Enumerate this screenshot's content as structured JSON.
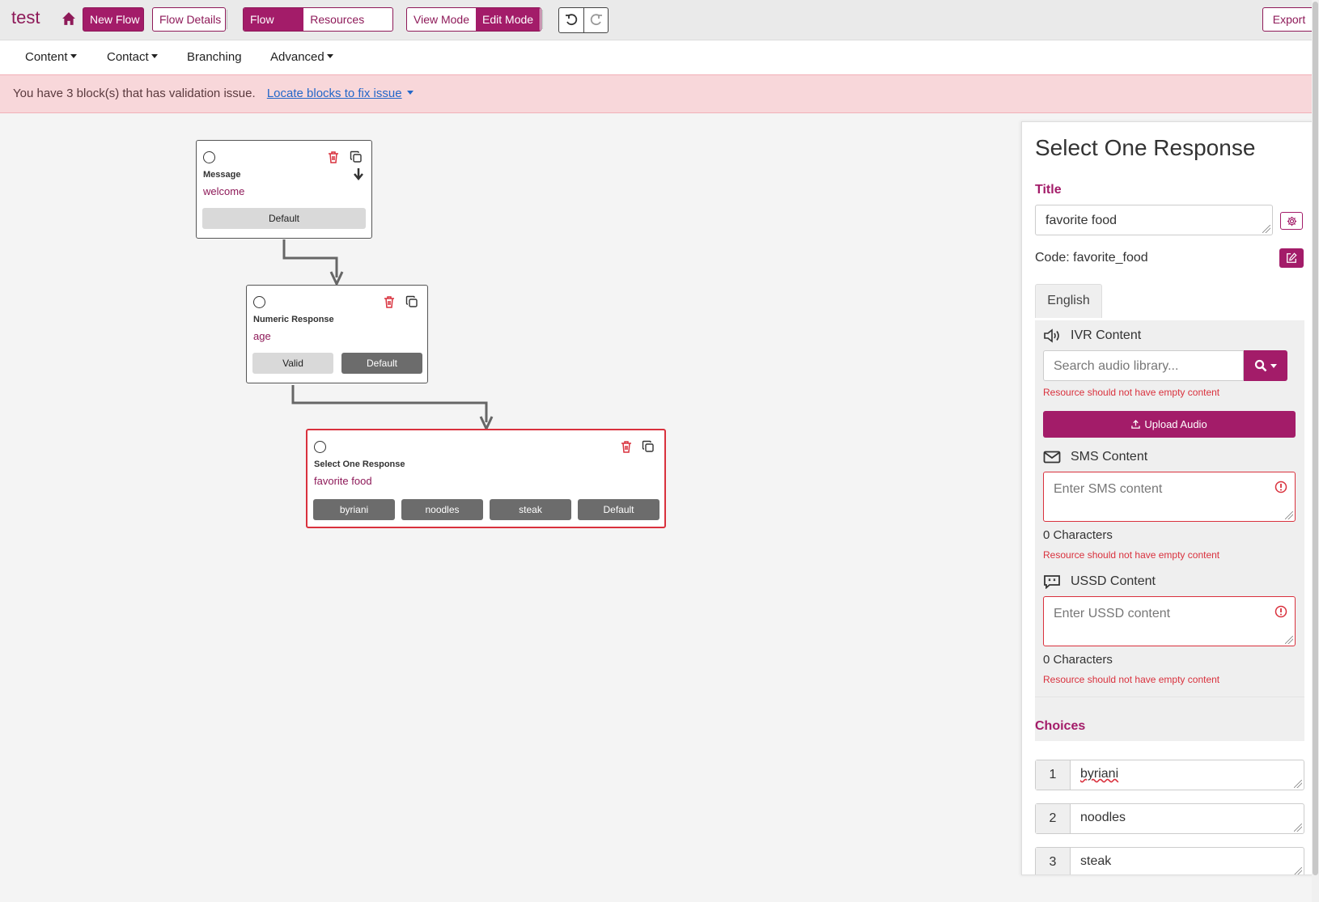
{
  "app": {
    "title": "test"
  },
  "toolbar": {
    "new_flow": "New Flow",
    "flow_details": "Flow Details",
    "flow_view": "Flow view",
    "resources_view": "Resources view",
    "view_mode": "View Mode",
    "edit_mode": "Edit Mode",
    "export": "Export"
  },
  "menu": {
    "content": "Content",
    "contact": "Contact",
    "branching": "Branching",
    "advanced": "Advanced"
  },
  "alert": {
    "message": "You have 3 block(s) that has validation issue.",
    "link": "Locate blocks to fix issue"
  },
  "canvas": {
    "nodes": [
      {
        "type": "Message",
        "label": "welcome",
        "exits": [
          "Default"
        ]
      },
      {
        "type": "Numeric Response",
        "label": "age",
        "exits": [
          "Valid",
          "Default"
        ]
      },
      {
        "type": "Select One Response",
        "label": "favorite food",
        "exits": [
          "byriani",
          "noodles",
          "steak",
          "Default"
        ]
      }
    ]
  },
  "panel": {
    "title": "Select One Response",
    "title_label": "Title",
    "title_value": "favorite food",
    "code_text": "Code: favorite_food",
    "language_tab": "English",
    "ivr": {
      "heading": "IVR Content",
      "placeholder": "Search audio library...",
      "error": "Resource should not have empty content",
      "upload_label": "Upload Audio"
    },
    "sms": {
      "heading": "SMS Content",
      "placeholder": "Enter SMS content",
      "count": "0 Characters",
      "error": "Resource should not have empty content"
    },
    "ussd": {
      "heading": "USSD Content",
      "placeholder": "Enter USSD content",
      "count": "0 Characters",
      "error": "Resource should not have empty content"
    },
    "choices_label": "Choices",
    "choices": [
      {
        "num": "1",
        "value": "byriani"
      },
      {
        "num": "2",
        "value": "noodles"
      },
      {
        "num": "3",
        "value": "steak"
      }
    ]
  },
  "colors": {
    "brand": "#a31c69",
    "error": "#d9313d",
    "alert_bg": "#f8d7da"
  },
  "icons": [
    "home-icon",
    "undo-icon",
    "redo-icon",
    "trash-icon",
    "copy-icon",
    "arrow-down-icon",
    "gear-icon",
    "edit-icon",
    "speaker-icon",
    "search-icon",
    "upload-icon",
    "envelope-icon",
    "message-icon",
    "error-icon"
  ]
}
